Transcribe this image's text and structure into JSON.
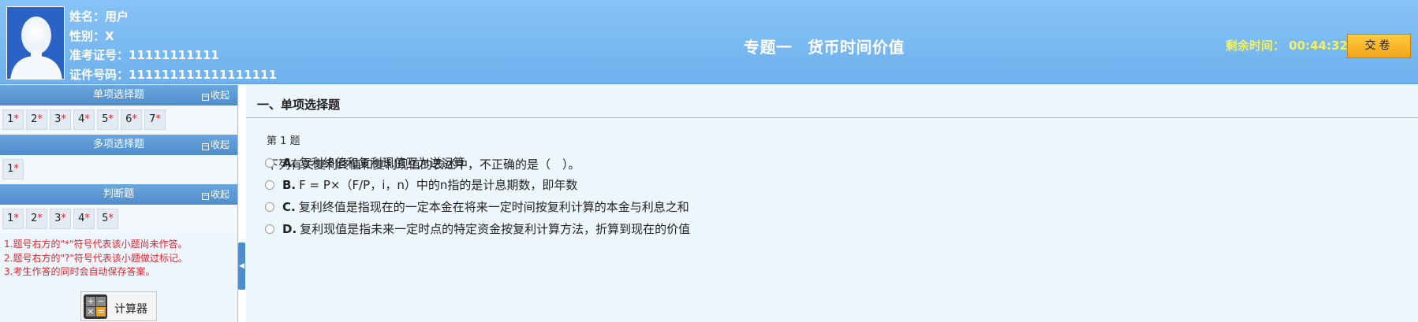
{
  "candidate": {
    "name_label": "姓名：",
    "name": "用户",
    "gender_label": "性别：",
    "gender": "X",
    "admission_label": "准考证号：",
    "admission": "11111111111",
    "id_label": "证件号码：",
    "id": "111111111111111111"
  },
  "exam": {
    "title": "专题一 货币时间价值"
  },
  "timer": {
    "label": "剩余时间：",
    "value": "00:44:32"
  },
  "submit_label": "交卷",
  "sidebar": {
    "collapse_label": "收起",
    "sections": [
      {
        "title": "单项选择题",
        "questions": [
          "1",
          "2",
          "3",
          "4",
          "5",
          "6",
          "7"
        ]
      },
      {
        "title": "多项选择题",
        "questions": [
          "1"
        ]
      },
      {
        "title": "判断题",
        "questions": [
          "1",
          "2",
          "3",
          "4",
          "5"
        ]
      }
    ],
    "status_mark": "*",
    "notes": [
      "1.题号右方的\"*\"符号代表该小题尚未作答。",
      "2.题号右方的\"?\"符号代表该小题做过标记。",
      "3.考生作答的同时会自动保存答案。"
    ],
    "calculator_label": "计算器"
  },
  "main": {
    "section_title": "一、单项选择题",
    "question_number": "第 1 题",
    "question_text": "下列有关复利终值和复利现值的表述中，不正确的是（　）。",
    "options": [
      {
        "key": "A.",
        "text": "复利终值和复利现值互为逆运算"
      },
      {
        "key": "B.",
        "text": "F = P×（F/P，i，n）中的n指的是计息期数，即年数"
      },
      {
        "key": "C.",
        "text": "复利终值是指现在的一定本金在将来一定时间按复利计算的本金与利息之和"
      },
      {
        "key": "D.",
        "text": "复利现值是指未来一定时点的特定资金按复利计算方法，折算到现在的价值"
      }
    ]
  }
}
